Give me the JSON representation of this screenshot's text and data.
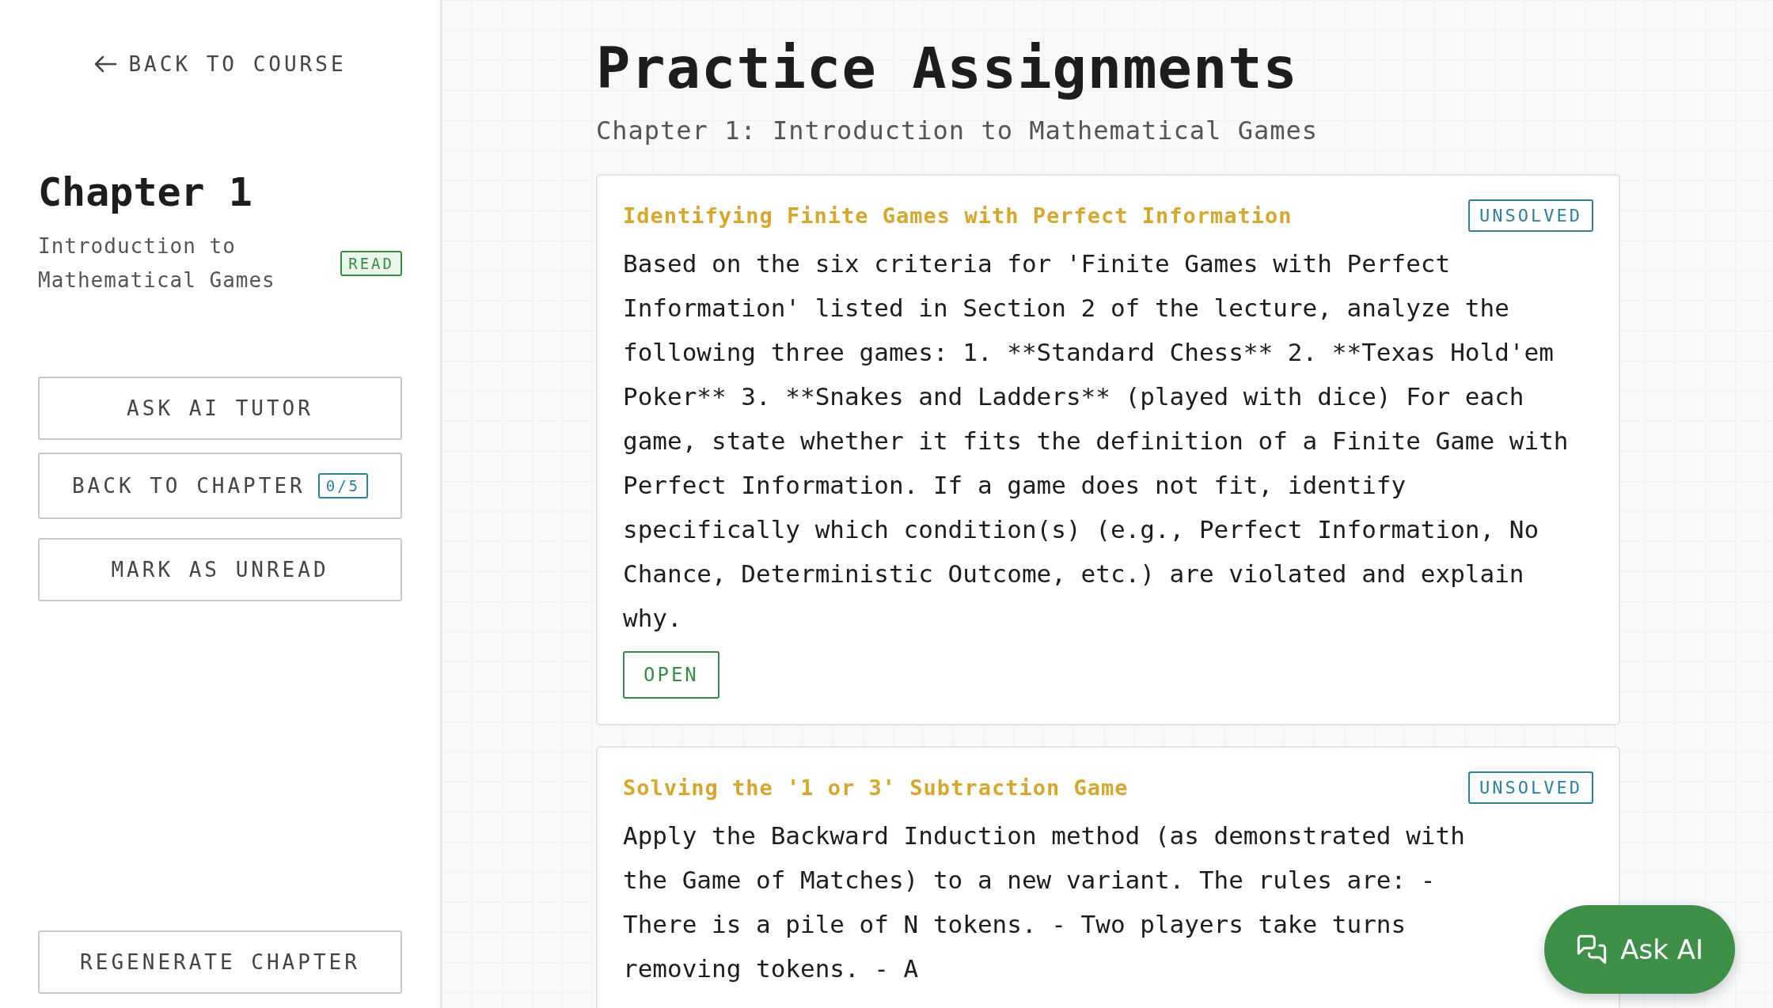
{
  "sidebar": {
    "back_link": "BACK TO COURSE",
    "chapter_title": "Chapter 1",
    "chapter_subtitle": "Introduction to Mathematical Games",
    "status_badge": "READ",
    "buttons": [
      {
        "label": "ASK AI TUTOR"
      },
      {
        "label": "BACK TO CHAPTER",
        "badge": "0/5"
      },
      {
        "label": "MARK AS UNREAD"
      }
    ],
    "footer_button": "REGENERATE CHAPTER"
  },
  "main": {
    "title": "Practice Assignments",
    "subtitle": "Chapter 1: Introduction to Mathematical Games",
    "assignments": [
      {
        "title": "Identifying Finite Games with Perfect Information",
        "status": "UNSOLVED",
        "body": "Based on the six criteria for 'Finite Games with Perfect Information' listed in Section 2 of the lecture, analyze the following three games: 1. **Standard Chess** 2. **Texas Hold'em Poker** 3. **Snakes and Ladders** (played with dice) For each game, state whether it fits the definition of a Finite Game with Perfect Information. If a game does not fit, identify specifically which condition(s) (e.g., Perfect Information, No Chance, Deterministic Outcome, etc.) are violated and explain why.",
        "action": "OPEN"
      },
      {
        "title": "Solving the '1 or 3' Subtraction Game",
        "status": "UNSOLVED",
        "body": "Apply the Backward Induction method (as demonstrated with the Game of Matches) to a new variant. The rules are: - There is a pile of N tokens. - Two players take turns removing tokens. - A"
      }
    ]
  },
  "ask_ai_button": "Ask AI"
}
